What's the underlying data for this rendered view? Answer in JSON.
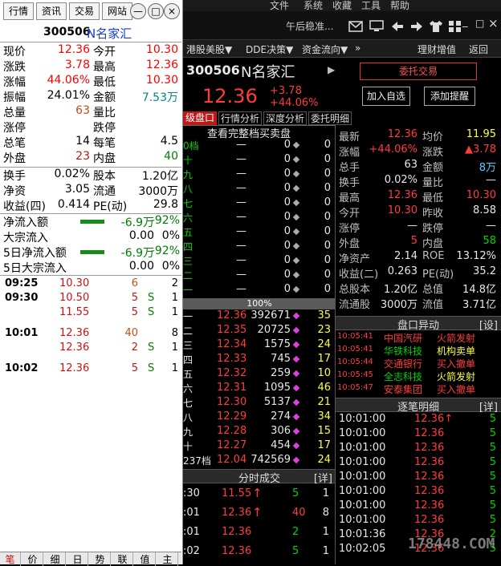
{
  "top_menu": {
    "items": [
      "文件",
      "系统",
      "收藏",
      "工具",
      "帮助"
    ]
  },
  "marquee": "午后稳准...",
  "toolbar_right": {
    "left_icons": [
      "mail-icon",
      "monitor-icon",
      "back-arrow-icon",
      "forward-arrow-icon",
      "shirt-icon",
      "grid-icon"
    ],
    "win_buttons": [
      "_",
      "□",
      "×"
    ]
  },
  "nav": {
    "items": [
      "港股美股▼",
      "DDE决策▼",
      "资金流向▼",
      "»"
    ],
    "right": [
      "理财增值",
      "返回"
    ]
  },
  "stock": {
    "code": "300506",
    "name": "N名家汇",
    "price": "12.36",
    "change": "+3.78",
    "change_pct": "+44.06%"
  },
  "actions": {
    "trade": "委托交易",
    "add_fav": "加入自选",
    "alert": "添加提醒"
  },
  "subtabs": [
    "级盘口",
    "行情分析",
    "深度分析",
    "委托明细"
  ],
  "full_book_link": "查看完整档买卖盘",
  "sell_rows": [
    {
      "lvl": "0档",
      "price": "—",
      "vol": "0",
      "n": "0"
    },
    {
      "lvl": "十",
      "price": "—",
      "vol": "0",
      "n": "0"
    },
    {
      "lvl": "九",
      "price": "—",
      "vol": "0",
      "n": "0"
    },
    {
      "lvl": "八",
      "price": "—",
      "vol": "0",
      "n": "0"
    },
    {
      "lvl": "七",
      "price": "—",
      "vol": "0",
      "n": "0"
    },
    {
      "lvl": "六",
      "price": "—",
      "vol": "0",
      "n": "0"
    },
    {
      "lvl": "五",
      "price": "—",
      "vol": "0",
      "n": "0"
    },
    {
      "lvl": "四",
      "price": "—",
      "vol": "0",
      "n": "0"
    },
    {
      "lvl": "三",
      "price": "—",
      "vol": "0",
      "n": "0"
    },
    {
      "lvl": "二",
      "price": "—",
      "vol": "0",
      "n": "0"
    },
    {
      "lvl": "一",
      "price": "—",
      "vol": "0",
      "n": "0"
    }
  ],
  "ratio_bar": "100%",
  "buy_rows": [
    {
      "lvl": "一",
      "price": "12.36",
      "vol": "392671",
      "n": "35"
    },
    {
      "lvl": "二",
      "price": "12.35",
      "vol": "20725",
      "n": "23"
    },
    {
      "lvl": "三",
      "price": "12.34",
      "vol": "1575",
      "n": "24"
    },
    {
      "lvl": "四",
      "price": "12.33",
      "vol": "745",
      "n": "17"
    },
    {
      "lvl": "五",
      "price": "12.32",
      "vol": "259",
      "n": "10"
    },
    {
      "lvl": "六",
      "price": "12.31",
      "vol": "1095",
      "n": "46"
    },
    {
      "lvl": "七",
      "price": "12.30",
      "vol": "5137",
      "n": "21"
    },
    {
      "lvl": "八",
      "price": "12.29",
      "vol": "274",
      "n": "34"
    },
    {
      "lvl": "九",
      "price": "12.28",
      "vol": "306",
      "n": "15"
    },
    {
      "lvl": "十",
      "price": "12.27",
      "vol": "454",
      "n": "17"
    },
    {
      "lvl": "237档",
      "price": "12.04",
      "vol": "742569",
      "n": "24"
    }
  ],
  "time_trades_title": "分时成交",
  "time_trades_detail": "[详]",
  "time_trades": [
    {
      "t": ":30",
      "price": "11.55",
      "vol": "5",
      "n": "1"
    },
    {
      "t": ":01",
      "price": "12.36",
      "vol": "40",
      "n": "8"
    },
    {
      "t": ":01",
      "price": "12.36",
      "vol": "2",
      "n": "1"
    },
    {
      "t": ":02",
      "price": "12.36",
      "vol": "5",
      "n": "1"
    }
  ],
  "quote": [
    {
      "l1": "最新",
      "v1": "12.36",
      "l2": "均价",
      "v2": "11.95"
    },
    {
      "l1": "涨幅",
      "v1": "+44.06%",
      "l2": "涨跌",
      "v2": "▲3.78"
    },
    {
      "l1": "总手",
      "v1": "63",
      "l2": "金额",
      "v2": "8万"
    },
    {
      "l1": "换手",
      "v1": "0.02%",
      "l2": "量比",
      "v2": "—"
    },
    {
      "l1": "最高",
      "v1": "12.36",
      "l2": "最低",
      "v2": "10.30"
    },
    {
      "l1": "今开",
      "v1": "10.30",
      "l2": "昨收",
      "v2": "8.58"
    },
    {
      "l1": "涨停",
      "v1": "—",
      "l2": "跌停",
      "v2": "—"
    },
    {
      "l1": "外盘",
      "v1": "5",
      "l2": "内盘",
      "v2": "58"
    },
    {
      "l1": "净资产",
      "v1": "2.14",
      "l2": "ROE",
      "v2": "13.12%"
    },
    {
      "l1": "收益(二)",
      "v1": "0.263",
      "l2": "PE(动)",
      "v2": "35.2"
    },
    {
      "l1": "总股本",
      "v1": "1.20亿",
      "l2": "总值",
      "v2": "14.8亿"
    },
    {
      "l1": "流通股",
      "v1": "3000万",
      "l2": "流值",
      "v2": "3.71亿"
    }
  ],
  "movers_title": "盘口异动",
  "movers_detail": "[设]",
  "movers": [
    {
      "t": "10:05:41",
      "name": "中国汽研",
      "ev": "火箭发射"
    },
    {
      "t": "10:05:41",
      "name": "华铁科技",
      "ev": "机构卖单"
    },
    {
      "t": "10:05:44",
      "name": "交通银行",
      "ev": "买入撤单"
    },
    {
      "t": "10:05:45",
      "name": "全志科技",
      "ev": "火箭发射"
    },
    {
      "t": "10:05:47",
      "name": "安泰集团",
      "ev": "买入撤单"
    }
  ],
  "ticks_title": "逐笔明细",
  "ticks_detail": "[详]",
  "ticks": [
    {
      "t": "10:01:00",
      "price": "12.36↑",
      "vol": "5"
    },
    {
      "t": "10:01:00",
      "price": "12.36",
      "vol": "5"
    },
    {
      "t": "10:01:00",
      "price": "12.36",
      "vol": "5"
    },
    {
      "t": "10:01:00",
      "price": "12.36",
      "vol": "5"
    },
    {
      "t": "10:01:00",
      "price": "12.36",
      "vol": "5"
    },
    {
      "t": "10:01:00",
      "price": "12.36",
      "vol": "5"
    },
    {
      "t": "10:01:00",
      "price": "12.36",
      "vol": "5"
    },
    {
      "t": "10:01:00",
      "price": "12.36",
      "vol": "5"
    },
    {
      "t": "10:01:36",
      "price": "12.36",
      "vol": "2"
    },
    {
      "t": "10:02:05",
      "price": "12.36",
      "vol": "5"
    }
  ],
  "watermark": "178448.COM",
  "left": {
    "tabs": [
      "行情",
      "资讯",
      "交易",
      "网站"
    ],
    "circle_buttons": [
      "—",
      "□",
      "×"
    ],
    "code": "300506",
    "name": "N名家汇",
    "rows": [
      {
        "l1": "现价",
        "v1": "12.36",
        "l2": "今开",
        "v2": "10.30"
      },
      {
        "l1": "涨跌",
        "v1": "3.78",
        "l2": "最高",
        "v2": "12.36"
      },
      {
        "l1": "涨幅",
        "v1": "44.06%",
        "l2": "最低",
        "v2": "10.30"
      },
      {
        "l1": "振幅",
        "v1": "24.01%",
        "l2": "金额",
        "v2": "7.53万"
      },
      {
        "l1": "总量",
        "v1": "63",
        "l2": "量比",
        "v2": ""
      },
      {
        "l1": "涨停",
        "v1": "",
        "l2": "跌停",
        "v2": ""
      },
      {
        "l1": "总笔",
        "v1": "14",
        "l2": "每笔",
        "v2": "4.5"
      },
      {
        "l1": "外盘",
        "v1": "23",
        "l2": "内盘",
        "v2": "40"
      }
    ],
    "fund_rows": [
      {
        "l1": "换手",
        "v1": "0.02%",
        "l2": "股本",
        "v2": "1.20亿"
      },
      {
        "l1": "净资",
        "v1": "3.05",
        "l2": "流通",
        "v2": "3000万"
      },
      {
        "l1": "收益(四)",
        "v1": "0.414",
        "l2": "PE(动)",
        "v2": "29.8"
      }
    ],
    "flow_rows": [
      {
        "label": "净流入额",
        "v1": "-6.9万",
        "v2": "-92%"
      },
      {
        "label": "大宗流入",
        "v1": "0.00",
        "v2": "0%"
      },
      {
        "label": "5日净流入额",
        "v1": "-6.9万",
        "v2": "-92%"
      },
      {
        "label": "5日大宗流入",
        "v1": "0.00",
        "v2": "0%"
      }
    ],
    "trades": [
      {
        "t": "09:25",
        "price": "10.30",
        "vol": "6",
        "s": "",
        "n": "2"
      },
      {
        "t": "09:30",
        "price": "10.50",
        "vol": "5",
        "s": "S",
        "n": "1"
      },
      {
        "t": "",
        "price": "11.55",
        "vol": "5",
        "s": "S",
        "n": "1"
      },
      {
        "t": "10:01",
        "price": "12.36",
        "vol": "40",
        "s": "",
        "n": "8"
      },
      {
        "t": "",
        "price": "12.36",
        "vol": "2",
        "s": "S",
        "n": "1"
      },
      {
        "t": "10:02",
        "price": "12.36",
        "vol": "5",
        "s": "S",
        "n": "1"
      }
    ],
    "bottom_tabs": [
      "笔",
      "价",
      "细",
      "日",
      "势",
      "联",
      "值",
      "主"
    ]
  }
}
